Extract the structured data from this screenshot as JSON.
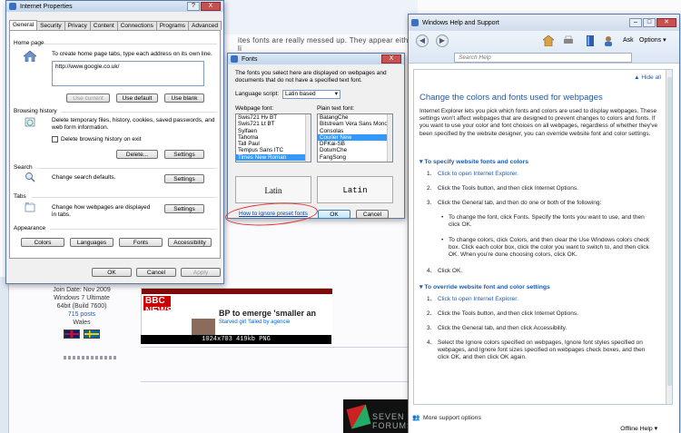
{
  "background": {
    "topic_text": "ites fonts are really messed up. They appear either li",
    "user": {
      "join_date": "Join Date: Nov 2009",
      "os": "Windows 7 Ultimate",
      "build": "64bit (Build 7600)",
      "posts": "715 posts",
      "location": "Wales"
    },
    "thumbnail_caption": "1024x703 419kb PNG",
    "thumbnail_headline": "BP to emerge 'smaller an",
    "thumbnail_sub": "Starved girl 'failed by agencie",
    "thumbnail_logo": "BBC NEWS",
    "banner_text": "SEVEN FORUMS"
  },
  "ie_properties": {
    "title": "Internet Properties",
    "help_btn": "?",
    "close_btn": "X",
    "tabs": [
      "General",
      "Security",
      "Privacy",
      "Content",
      "Connections",
      "Programs",
      "Advanced"
    ],
    "active_tab": "General",
    "home_page": {
      "label": "Home page",
      "desc": "To create home page tabs, type each address on its own line.",
      "url": "http://www.google.co.uk/",
      "btn_current": "Use current",
      "btn_default": "Use default",
      "btn_blank": "Use blank"
    },
    "browsing_history": {
      "label": "Browsing history",
      "desc": "Delete temporary files, history, cookies, saved passwords, and web form information.",
      "checkbox": "Delete browsing history on exit",
      "btn_delete": "Delete...",
      "btn_settings": "Settings"
    },
    "search": {
      "label": "Search",
      "desc": "Change search defaults.",
      "btn_settings": "Settings"
    },
    "tabs_group": {
      "label": "Tabs",
      "desc": "Change how webpages are displayed in tabs.",
      "btn_settings": "Settings"
    },
    "appearance": {
      "label": "Appearance",
      "btn_colors": "Colors",
      "btn_languages": "Languages",
      "btn_fonts": "Fonts",
      "btn_accessibility": "Accessibility"
    },
    "footer": {
      "ok": "OK",
      "cancel": "Cancel",
      "apply": "Apply"
    }
  },
  "fonts_dialog": {
    "title": "Fonts",
    "close_btn": "X",
    "desc": "The fonts you select here are displayed on webpages and documents that do not have a specified text font.",
    "language_label": "Language script:",
    "language_value": "Latin based",
    "webpage_label": "Webpage font:",
    "plain_label": "Plain text font:",
    "webpage_fonts": [
      "Swis721 Hv BT",
      "Swis721 Lt BT",
      "Sylfaen",
      "Tahoma",
      "Tall Paul",
      "Tempus Sans ITC",
      "Times New Roman"
    ],
    "webpage_selected": "Times New Roman",
    "plain_fonts": [
      "BatangChe",
      "Bitstream Vera Sans Mono",
      "Consolas",
      "Courier New",
      "DFKai-SB",
      "DotumChe",
      "FangSong"
    ],
    "plain_selected": "Courier New",
    "preview_left": "Latin",
    "preview_right": "Latin",
    "link": "How to ignore preset fonts",
    "ok": "OK",
    "cancel": "Cancel"
  },
  "help_window": {
    "title": "Windows Help and Support",
    "ask": "Ask",
    "options": "Options",
    "search_placeholder": "Search Help",
    "hide_all": "Hide all",
    "heading": "Change the colors and fonts used for webpages",
    "intro": "Internet Explorer lets you pick which fonts and colors are used to display webpages. These settings won't affect webpages that are designed to prevent changes to colors and fonts. If you want to use your color and font choices on all webpages, regardless of whether they've been specified by the website designer, you can override website font and color settings.",
    "section1": "To specify website fonts and colors",
    "s1_step1": "Click to open Internet Explorer.",
    "s1_step2": "Click the Tools button, and then click Internet Options.",
    "s1_step3": "Click the General tab, and then do one or both of the following:",
    "s1_bullet1": "To change the font, click Fonts. Specify the fonts you want to use, and then click OK.",
    "s1_bullet2": "To change colors, click Colors, and then clear the Use Windows colors check box. Click each color box, click the color you want to switch to, and then click OK. When you're done choosing colors, click OK.",
    "s1_step4": "Click OK.",
    "section2": "To override website font and color settings",
    "s2_step1": "Click to open Internet Explorer.",
    "s2_step2": "Click the Tools button, and then click Internet Options.",
    "s2_step3": "Click the General tab, and then click Accessibility.",
    "s2_step4": "Select the Ignore colors specified on webpages, Ignore font styles specified on webpages, and Ignore font sizes specified on webpages check boxes, and then click OK, and then click OK again.",
    "more_support": "More support options",
    "offline_help": "Offline Help"
  }
}
